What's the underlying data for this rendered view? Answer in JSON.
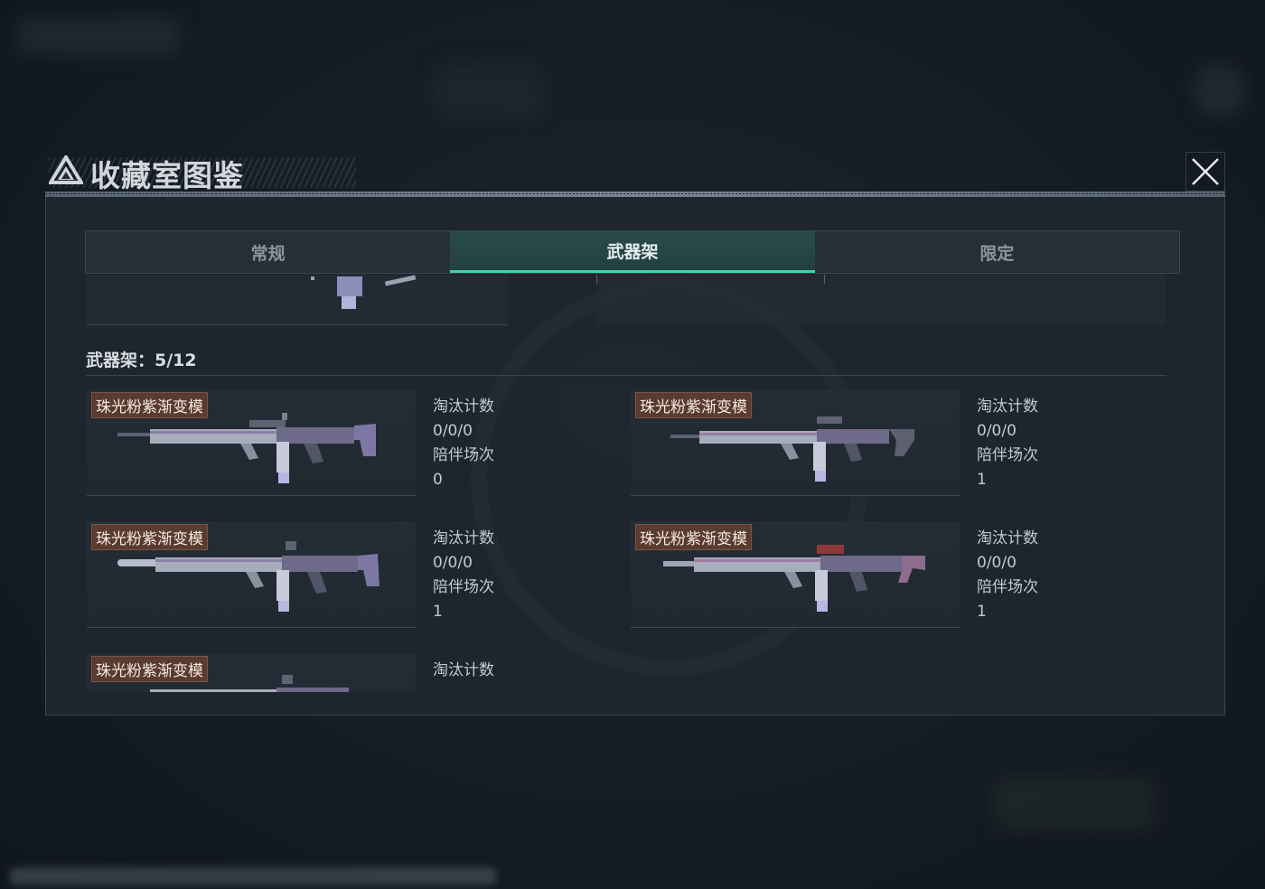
{
  "header": {
    "title": "收藏室图鉴",
    "close_icon": "close-icon"
  },
  "tabs": [
    {
      "label": "常规",
      "active": false
    },
    {
      "label": "武器架",
      "active": true
    },
    {
      "label": "限定",
      "active": false
    }
  ],
  "section": {
    "title": "武器架：5/12"
  },
  "cards": [
    {
      "skin": "珠光粉紫渐变模",
      "kills_label": "淘汰计数",
      "kills": "0/0/0",
      "matches_label": "陪伴场次",
      "matches": "0"
    },
    {
      "skin": "珠光粉紫渐变模",
      "kills_label": "淘汰计数",
      "kills": "0/0/0",
      "matches_label": "陪伴场次",
      "matches": "1"
    },
    {
      "skin": "珠光粉紫渐变模",
      "kills_label": "淘汰计数",
      "kills": "0/0/0",
      "matches_label": "陪伴场次",
      "matches": "1"
    },
    {
      "skin": "珠光粉紫渐变模",
      "kills_label": "淘汰计数",
      "kills": "0/0/0",
      "matches_label": "陪伴场次",
      "matches": "1"
    },
    {
      "skin": "珠光粉紫渐变模",
      "kills_label": "淘汰计数"
    }
  ],
  "colors": {
    "accent": "#3bd6a8",
    "tag_bg": "#5a3b30",
    "panel_bg": "#1e262f"
  }
}
